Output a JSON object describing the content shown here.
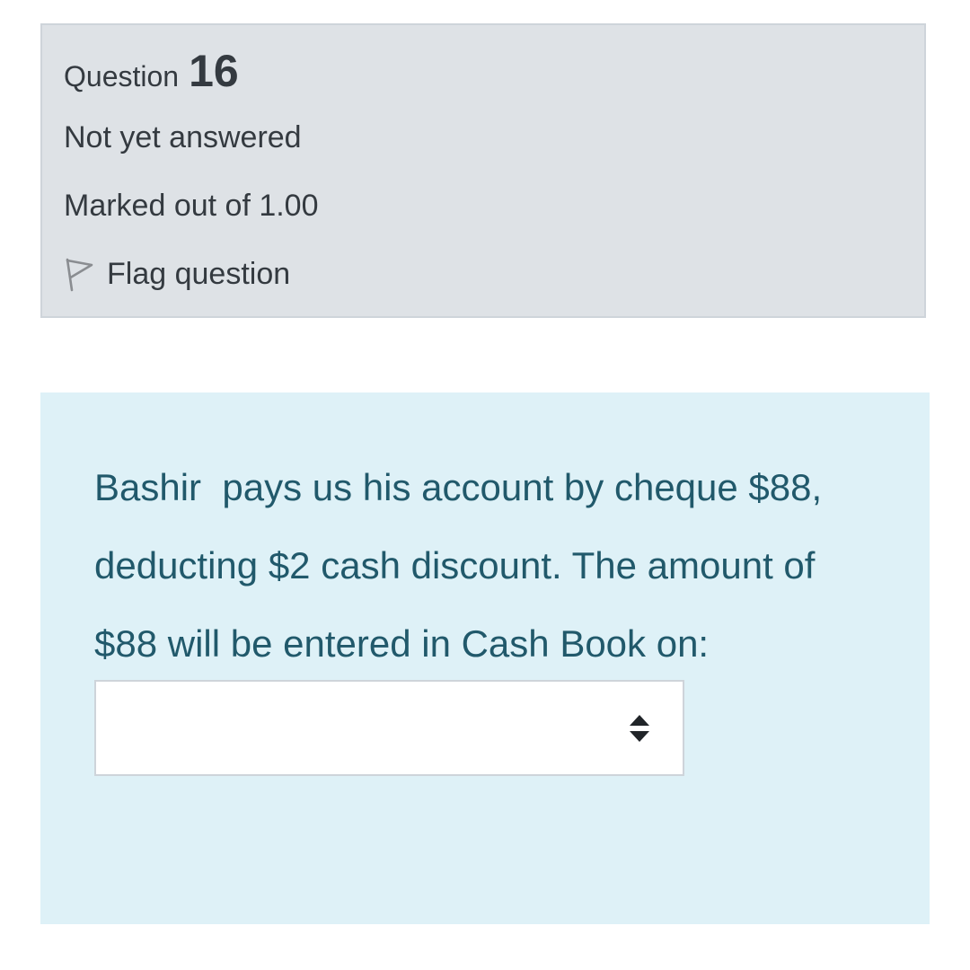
{
  "question_info": {
    "label": "Question",
    "number": "16",
    "state": "Not yet answered",
    "grade": "Marked out of 1.00",
    "flag_label": "Flag question"
  },
  "question": {
    "text": "Bashir  pays us his account by cheque $88,\ndeducting $2 cash discount. The amount of\n$88 will be entered in Cash Book on:",
    "answer_selected": ""
  },
  "icons": {
    "flag": "flag-outline-icon",
    "select_arrows": "sort-arrows-icon"
  },
  "colors": {
    "info_bg": "#dee2e6",
    "info_border": "#ced4da",
    "question_bg": "#def1f7",
    "question_text": "#21596b",
    "body_text": "#343a40"
  }
}
